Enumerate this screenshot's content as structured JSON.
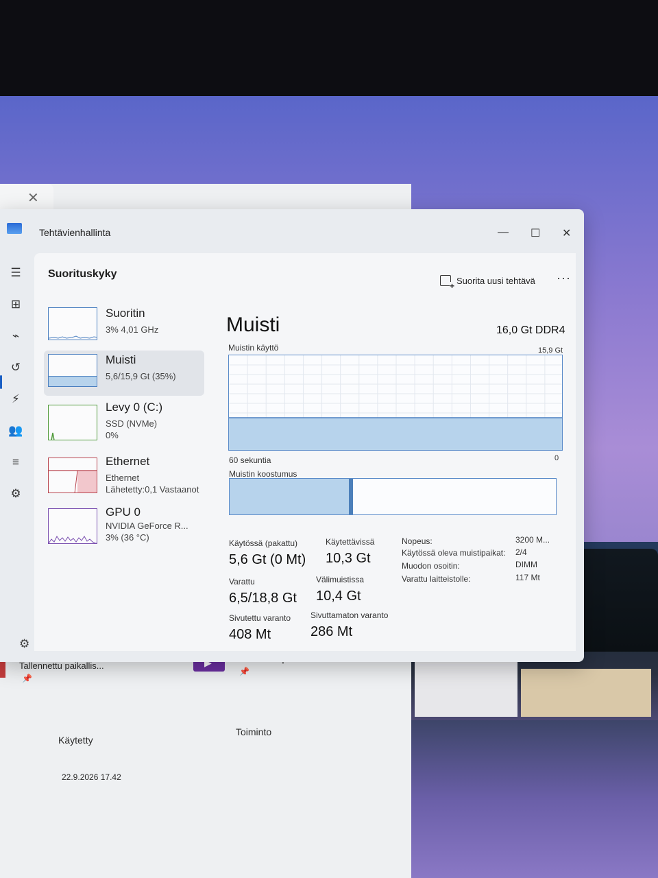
{
  "window": {
    "title": "Tehtävienhallinta",
    "minimize": "—",
    "maximize": "☐",
    "close": "✕"
  },
  "toolbar": {
    "section_title": "Suorituskyky",
    "run_task_label": "Suorita uusi tehtävä",
    "more": "···"
  },
  "sidebar": {
    "items": [
      {
        "name": "menu-icon",
        "glyph": "☰"
      },
      {
        "name": "processes-icon",
        "glyph": "⊞"
      },
      {
        "name": "performance-icon",
        "glyph": "⌁"
      },
      {
        "name": "app-history-icon",
        "glyph": "↺"
      },
      {
        "name": "startup-icon",
        "glyph": "⚡"
      },
      {
        "name": "users-icon",
        "glyph": "👥"
      },
      {
        "name": "details-icon",
        "glyph": "≡"
      },
      {
        "name": "services-icon",
        "glyph": "⚙"
      }
    ],
    "settings_glyph": "⚙"
  },
  "devices": [
    {
      "name": "Suoritin",
      "line1": "3% 4,01 GHz",
      "line2": "",
      "line3": "",
      "selected": false
    },
    {
      "name": "Muisti",
      "line1": "5,6/15,9 Gt (35%)",
      "line2": "",
      "line3": "",
      "selected": true
    },
    {
      "name": "Levy 0 (C:)",
      "line1": "SSD (NVMe)",
      "line2": "0%",
      "line3": "",
      "selected": false
    },
    {
      "name": "Ethernet",
      "line1": "Ethernet",
      "line2": "Lähetetty:0,1 Vastaanot",
      "line3": "",
      "selected": false
    },
    {
      "name": "GPU 0",
      "line1": "NVIDIA GeForce R...",
      "line2": "3% (36 °C)",
      "line3": "",
      "selected": false
    }
  ],
  "memory": {
    "title": "Muisti",
    "spec": "16,0 Gt DDR4",
    "usage_label": "Muistin käyttö",
    "usage_max": "15,9 Gt",
    "time_label": "60 sekuntia",
    "time_end": "0",
    "composition_label": "Muistin koostumus",
    "usage_fraction": 0.35,
    "composition_used_fraction": 0.37,
    "stats": {
      "in_use_label": "Käytössä (pakattu)",
      "in_use_value": "5,6 Gt (0 Mt)",
      "available_label": "Käytettävissä",
      "available_value": "10,3 Gt",
      "committed_label": "Varattu",
      "committed_value": "6,5/18,8 Gt",
      "cached_label": "Välimuistissa",
      "cached_value": "10,4 Gt",
      "paged_label": "Sivutettu varanto",
      "paged_value": "408 Mt",
      "nonpaged_label": "Sivuttamaton varanto",
      "nonpaged_value": "286 Mt"
    },
    "details": {
      "speed_key": "Nopeus:",
      "speed_val": "3200 M...",
      "slots_key": "Käytössä oleva muistipaikat:",
      "slots_val": "2/4",
      "form_key": "Muodon osoitin:",
      "form_val": "DIMM",
      "reserved_key": "Varattu laitteistolle:",
      "reserved_val": "117 Mt"
    }
  },
  "background_window": {
    "saved_local_1": "Tallennettu paikallis...",
    "saved_local_2": "Tallennettu paikallis...",
    "used_label": "Käytetty",
    "action_label": "Toiminto",
    "date": "22.9.2026 17.42",
    "close_glyph": "✕",
    "pin_glyph": "📌"
  }
}
